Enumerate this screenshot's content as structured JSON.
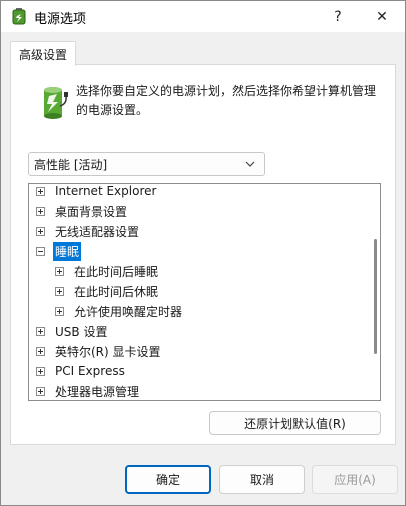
{
  "window": {
    "title": "电源选项",
    "help_label": "?",
    "close_label": "✕"
  },
  "tab": {
    "label": "高级设置"
  },
  "description": "选择你要自定义的电源计划，然后选择你希望计算机管理的电源设置。",
  "plan_select": {
    "value": "高性能 [活动]"
  },
  "tree": {
    "rows": [
      {
        "label": "Internet Explorer",
        "expanded": false
      },
      {
        "label": "桌面背景设置",
        "expanded": false
      },
      {
        "label": "无线适配器设置",
        "expanded": false
      },
      {
        "label": "睡眠",
        "expanded": true,
        "selected": true
      },
      {
        "label": "在此时间后睡眠",
        "expanded": false
      },
      {
        "label": "在此时间后休眠",
        "expanded": false
      },
      {
        "label": "允许使用唤醒定时器",
        "expanded": false
      },
      {
        "label": "USB 设置",
        "expanded": false
      },
      {
        "label": "英特尔(R) 显卡设置",
        "expanded": false
      },
      {
        "label": "PCI Express",
        "expanded": false
      },
      {
        "label": "处理器电源管理",
        "expanded": false
      }
    ]
  },
  "restore_button": "还原计划默认值(R)",
  "buttons": {
    "ok": "确定",
    "cancel": "取消",
    "apply": "应用(A)"
  },
  "colors": {
    "accent": "#0078d7",
    "ok_border": "#0067c0"
  }
}
